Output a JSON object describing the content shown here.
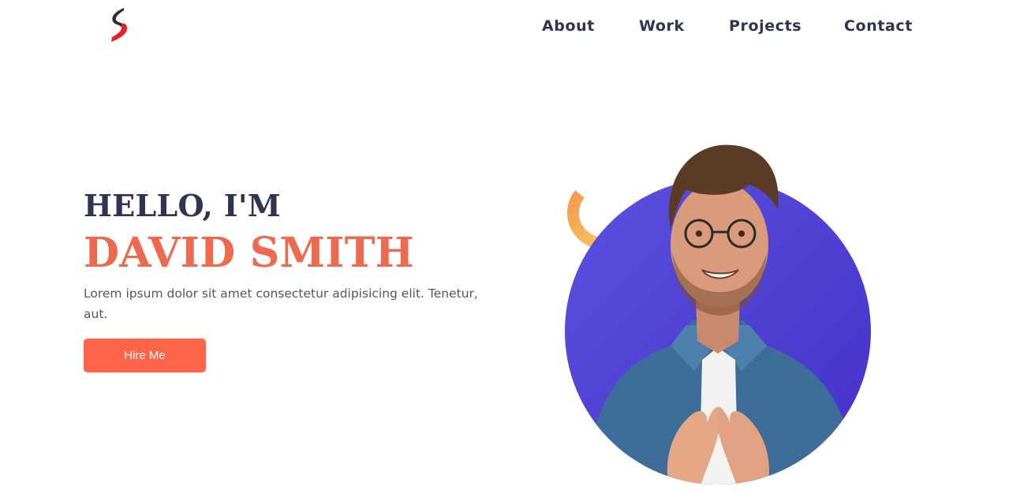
{
  "brand": {
    "logo_icon": "s-swoosh-logo",
    "colors": {
      "dark": "#2f3550",
      "accent": "#ee6a4f",
      "button": "#fe6448",
      "circle": "#4b3fd9",
      "ring": "#fcc35a"
    }
  },
  "nav": {
    "items": [
      {
        "label": "About"
      },
      {
        "label": "Work"
      },
      {
        "label": "Projects"
      },
      {
        "label": "Contact"
      }
    ]
  },
  "hero": {
    "greeting": "HELLO, I'M",
    "name": "DAVID SMITH",
    "description": "Lorem ipsum dolor sit amet consectetur adipisicing elit. Tenetur, aut.",
    "cta_label": "Hire Me",
    "portrait_icon": "person-portrait"
  }
}
